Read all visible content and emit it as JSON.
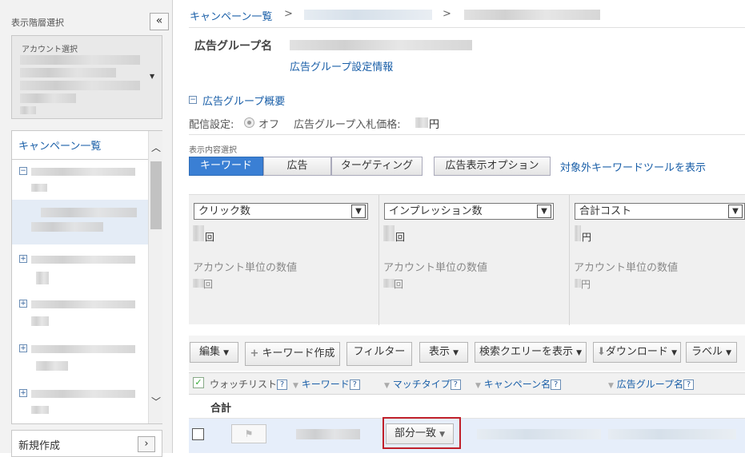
{
  "sidebar": {
    "title": "表示階層選択",
    "collapse": "«",
    "account_label": "アカウント選択",
    "campaign_header": "キャンペーン一覧",
    "tree_expanded": "−",
    "tree_collapsed": "+",
    "new_label": "新規作成",
    "new_arrow": "›"
  },
  "breadcrumb": {
    "root": "キャンペーン一覧",
    "sep": ">"
  },
  "adgroup": {
    "name_label": "広告グループ名",
    "settings_link": "広告グループ設定情報",
    "summary_toggle": "−",
    "summary_title": "広告グループ概要",
    "delivery_label": "配信設定:",
    "delivery_value": "オフ",
    "bid_label": "広告グループ入札価格:",
    "bid_unit": "円"
  },
  "view": {
    "label": "表示内容選択",
    "tabs": [
      "キーワード",
      "広告",
      "ターゲティング"
    ],
    "active_tab": "キーワード",
    "ad_options": "広告表示オプション",
    "keyword_tool_link": "対象外キーワードツールを表示"
  },
  "metrics": [
    {
      "select": "クリック数",
      "unit": "回",
      "account_label": "アカウント単位の数値",
      "account_unit": "回"
    },
    {
      "select": "インプレッション数",
      "unit": "回",
      "account_label": "アカウント単位の数値",
      "account_unit": "回"
    },
    {
      "select": "合計コスト",
      "unit": "円",
      "account_label": "アカウント単位の数値",
      "account_unit": "円"
    }
  ],
  "toolbar": {
    "edit": "編集",
    "create_keyword": "キーワード作成",
    "filter": "フィルター",
    "display": "表示",
    "search_query": "検索クエリーを表示",
    "download": "ダウンロード",
    "label": "ラベル"
  },
  "table": {
    "col_watchlist": "ウォッチリスト",
    "col_keyword": "キーワード",
    "col_match": "マッチタイプ",
    "col_campaign": "キャンペーン名",
    "col_adgroup": "広告グループ名",
    "help": "?",
    "total": "合計",
    "row_match": "部分一致"
  },
  "icons": {
    "check": "check-icon",
    "flag": "flag-icon",
    "plus": "plus-icon",
    "download": "download-icon"
  },
  "colors": {
    "accent": "#3a7fd4",
    "link": "#1a5fa8",
    "highlight": "#c0202a"
  }
}
